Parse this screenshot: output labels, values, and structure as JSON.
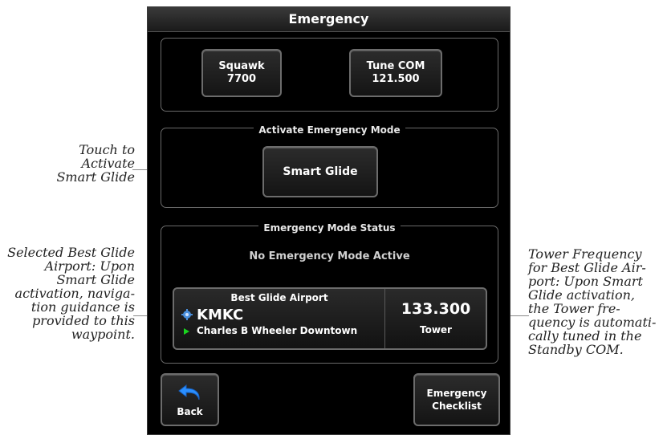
{
  "title": "Emergency",
  "top_buttons": {
    "squawk": {
      "label": "Squawk",
      "value": "7700"
    },
    "tune_com": {
      "label": "Tune COM",
      "value": "121.500"
    }
  },
  "activate_panel": {
    "legend": "Activate Emergency Mode",
    "smart_glide_label": "Smart Glide"
  },
  "status_panel": {
    "legend": "Emergency Mode Status",
    "status_text": "No Emergency Mode Active",
    "best_glide": {
      "title": "Best Glide Airport",
      "ident": "KMKC",
      "name": "Charles B Wheeler Downtown",
      "frequency": "133.300",
      "frequency_label": "Tower"
    }
  },
  "bottom_buttons": {
    "back_label": "Back",
    "checklist_line1": "Emergency",
    "checklist_line2": "Checklist"
  },
  "callouts": {
    "touch": [
      "Touch to",
      "Activate",
      "Smart Glide"
    ],
    "selected": [
      "Selected Best Glide",
      "Airport:  Upon",
      "Smart Glide",
      "activation, naviga-",
      "tion guidance is",
      "provided to this",
      "waypoint."
    ],
    "tower": [
      "Tower Frequency",
      "for Best Glide Air-",
      "port:  Upon Smart",
      "Glide activation,",
      "the Tower fre-",
      "quency is automati-",
      "cally tuned in the",
      "Standby COM."
    ]
  },
  "colors": {
    "accent_green": "#19d41e",
    "airport_blue": "#4a8fdc",
    "screen_bg": "#000000"
  }
}
